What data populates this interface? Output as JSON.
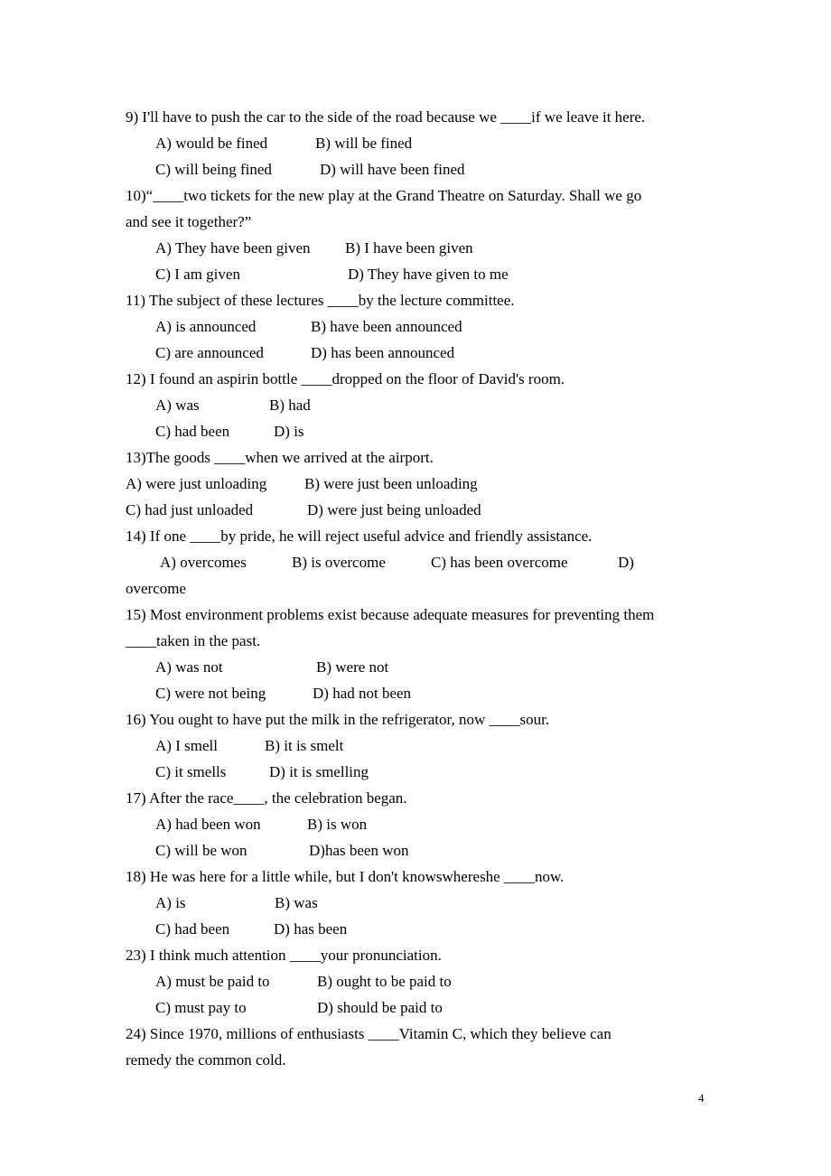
{
  "page_number": "4",
  "questions": [
    {
      "stem": [
        "9) I'll have to push the car to the side of the road because we ____if we leave it here."
      ],
      "options": [
        [
          "A) would be fined",
          "B) will be fined"
        ],
        [
          "C) will being fined",
          "D) will have been fined"
        ]
      ]
    },
    {
      "stem": [
        "10)“____two tickets for the new play at the Grand Theatre on Saturday. Shall we go",
        "and see it together?”"
      ],
      "options": [
        [
          "A) They have been given",
          "B) I have been given"
        ],
        [
          "C) I am given",
          "D) They have given to me"
        ]
      ]
    },
    {
      "stem": [
        "11) The subject of these lectures ____by the lecture committee."
      ],
      "options": [
        [
          "A) is announced",
          "B) have been announced"
        ],
        [
          "C) are announced",
          "D) has been announced"
        ]
      ]
    },
    {
      "stem": [
        "12) I found an aspirin bottle ____dropped on the floor of David's room."
      ],
      "options": [
        [
          "A) was",
          "B) had"
        ],
        [
          "C) had been",
          "D) is"
        ]
      ]
    },
    {
      "stem": [
        "13)The goods ____when we arrived at the airport."
      ],
      "options": [
        [
          "A) were just unloading",
          "B) were just been unloading"
        ],
        [
          "C) had just unloaded",
          "D) were just being unloaded"
        ]
      ]
    },
    {
      "stem": [
        "14) If one ____by pride, he will reject useful advice and friendly assistance."
      ],
      "options": [
        [
          "A) overcomes",
          "B) is overcome",
          "C) has been overcome",
          "D)"
        ]
      ],
      "continuation": "overcome"
    },
    {
      "stem": [
        "15) Most environment problems exist because adequate measures for preventing them",
        "____taken in the past."
      ],
      "options": [
        [
          "A) was not",
          "B) were not"
        ],
        [
          "C) were not being",
          "D) had not been"
        ]
      ]
    },
    {
      "stem": [
        "16) You ought to have put the milk in the refrigerator, now ____sour."
      ],
      "options": [
        [
          "A) I smell",
          "B) it is smelt"
        ],
        [
          "C) it smells",
          "D) it is smelling"
        ]
      ]
    },
    {
      "stem": [
        "17) After the race____, the celebration began."
      ],
      "options": [
        [
          "A) had been won",
          "B) is won"
        ],
        [
          "C) will be won",
          "D)has been won"
        ]
      ]
    },
    {
      "stem": [
        "18) He was here for a little while, but I don't knowswhereshe ____now."
      ],
      "options": [
        [
          "A) is",
          "B) was"
        ],
        [
          "C) had been",
          "D) has been"
        ]
      ]
    },
    {
      "stem": [
        "23) I think much attention ____your pronunciation."
      ],
      "options": [
        [
          "A) must be paid to",
          "B) ought to be paid to"
        ],
        [
          "C) must pay to",
          "D) should be paid to"
        ]
      ]
    },
    {
      "stem": [
        "24) Since 1970, millions of enthusiasts ____Vitamin C, which they believe can",
        "remedy the common cold."
      ],
      "options": []
    }
  ]
}
